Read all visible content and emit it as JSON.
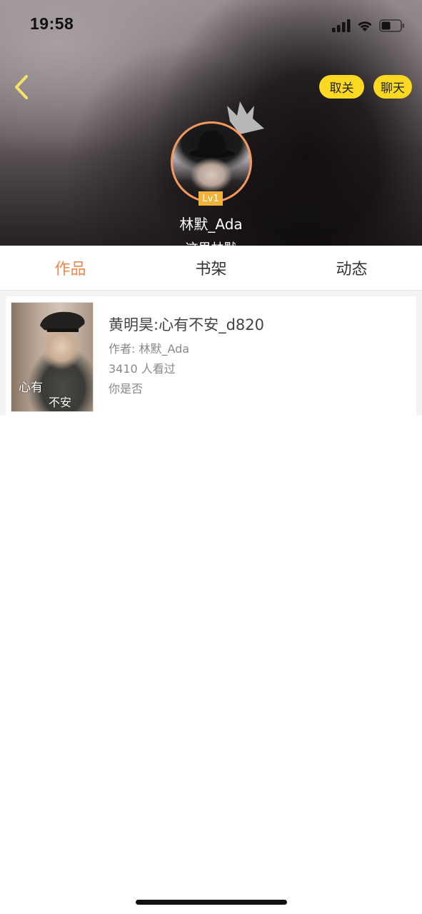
{
  "status_bar": {
    "time": "19:58",
    "icons": [
      "cellular-signal-icon",
      "wifi-icon",
      "battery-icon"
    ]
  },
  "header": {
    "back_icon": "chevron-left-icon",
    "unfollow_label": "取关",
    "chat_label": "聊天",
    "button_color": "#fbd923"
  },
  "profile": {
    "avatar_border_color": "#f39a5c",
    "level": "Lv1",
    "username": "林默_Ada",
    "signature": "这里林默"
  },
  "tabs": [
    {
      "label": "作品",
      "active": true
    },
    {
      "label": "书架",
      "active": false
    },
    {
      "label": "动态",
      "active": false
    }
  ],
  "accent_color": "#f0884d",
  "works": [
    {
      "cover_text_1": "心有",
      "cover_text_2": "不安",
      "title": "黄明昊:心有不安_d820",
      "author": "作者: 林默_Ada",
      "views": "3410 人看过",
      "intro": "你是否"
    }
  ]
}
